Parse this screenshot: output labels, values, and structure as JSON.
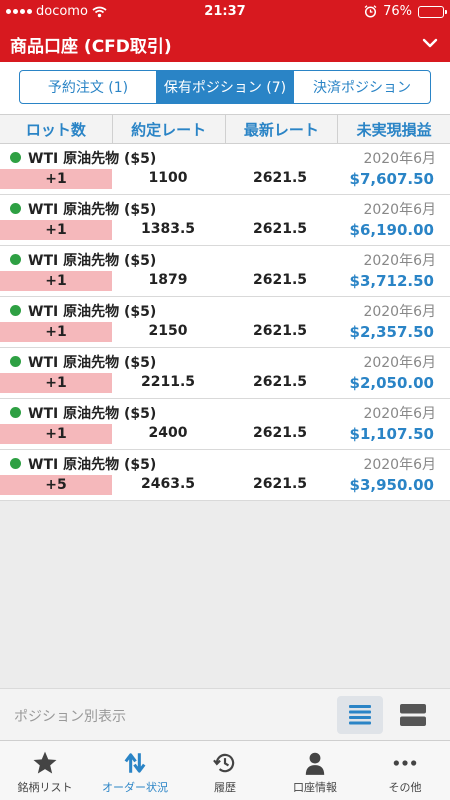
{
  "status_bar": {
    "carrier": "docomo",
    "time": "21:37",
    "battery": "76%",
    "battery_level": 0.76
  },
  "header": {
    "title": "商品口座 (CFD取引)"
  },
  "segments": [
    {
      "label": "予約注文 (1)",
      "active": false
    },
    {
      "label": "保有ポジション (7)",
      "active": true
    },
    {
      "label": "決済ポジション",
      "active": false
    }
  ],
  "columns": {
    "lot": "ロット数",
    "entry_rate": "約定レート",
    "latest_rate": "最新レート",
    "unrealized_pl": "未実現損益"
  },
  "positions": [
    {
      "name": "WTI 原油先物 ($5)",
      "contract": "2020年6月",
      "lot": "+1",
      "entry_rate": "1100",
      "latest_rate": "2621.5",
      "unrealized_pl": "$7,607.50"
    },
    {
      "name": "WTI 原油先物 ($5)",
      "contract": "2020年6月",
      "lot": "+1",
      "entry_rate": "1383.5",
      "latest_rate": "2621.5",
      "unrealized_pl": "$6,190.00"
    },
    {
      "name": "WTI 原油先物 ($5)",
      "contract": "2020年6月",
      "lot": "+1",
      "entry_rate": "1879",
      "latest_rate": "2621.5",
      "unrealized_pl": "$3,712.50"
    },
    {
      "name": "WTI 原油先物 ($5)",
      "contract": "2020年6月",
      "lot": "+1",
      "entry_rate": "2150",
      "latest_rate": "2621.5",
      "unrealized_pl": "$2,357.50"
    },
    {
      "name": "WTI 原油先物 ($5)",
      "contract": "2020年6月",
      "lot": "+1",
      "entry_rate": "2211.5",
      "latest_rate": "2621.5",
      "unrealized_pl": "$2,050.00"
    },
    {
      "name": "WTI 原油先物 ($5)",
      "contract": "2020年6月",
      "lot": "+1",
      "entry_rate": "2400",
      "latest_rate": "2621.5",
      "unrealized_pl": "$1,107.50"
    },
    {
      "name": "WTI 原油先物 ($5)",
      "contract": "2020年6月",
      "lot": "+5",
      "entry_rate": "2463.5",
      "latest_rate": "2621.5",
      "unrealized_pl": "$3,950.00"
    }
  ],
  "position_bar": {
    "label": "ポジション別表示"
  },
  "tabbar": [
    {
      "label": "銘柄リスト",
      "icon": "star-icon",
      "active": false
    },
    {
      "label": "オーダー状況",
      "icon": "transfer-arrows-icon",
      "active": true
    },
    {
      "label": "履歴",
      "icon": "history-clock-icon",
      "active": false
    },
    {
      "label": "口座情報",
      "icon": "person-icon",
      "active": false
    },
    {
      "label": "その他",
      "icon": "more-dots-icon",
      "active": false
    }
  ],
  "colors": {
    "brand_red": "#d7191f",
    "accent_blue": "#2a84c6",
    "long_position_green": "#2ea043",
    "lot_highlight_pink": "#f5b8bb"
  }
}
